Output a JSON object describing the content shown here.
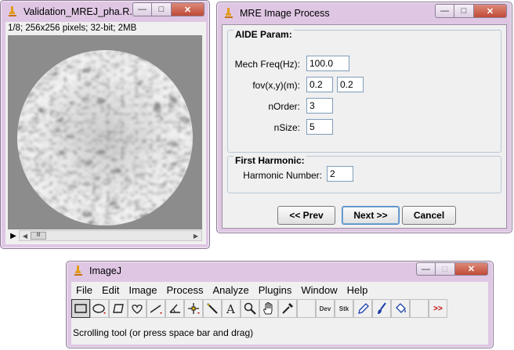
{
  "image_window": {
    "title": "Validation_MREJ_pha.R...",
    "info": "1/8; 256x256 pixels; 32-bit; 2MB",
    "scroll_thumb": "lll"
  },
  "mre_dialog": {
    "title": "MRE Image Process",
    "aide_section": "AIDE Param:",
    "mech_freq_label": "Mech Freq(Hz):",
    "mech_freq_value": "100.0",
    "fov_label": "fov(x,y)(m):",
    "fov_x_value": "0.2",
    "fov_y_value": "0.2",
    "norder_label": "nOrder:",
    "norder_value": "3",
    "nsize_label": "nSize:",
    "nsize_value": "5",
    "harmonic_section": "First Harmonic:",
    "harmonic_label": "Harmonic Number:",
    "harmonic_value": "2",
    "prev_button": "<< Prev",
    "next_button": "Next >>",
    "cancel_button": "Cancel"
  },
  "imagej": {
    "title": "ImageJ",
    "menus": [
      "File",
      "Edit",
      "Image",
      "Process",
      "Analyze",
      "Plugins",
      "Window",
      "Help"
    ],
    "tools": [
      {
        "name": "rectangle-tool",
        "icon": "rectangle-icon"
      },
      {
        "name": "oval-tool",
        "icon": "oval-icon"
      },
      {
        "name": "polygon-tool",
        "icon": "polygon-icon"
      },
      {
        "name": "freehand-tool",
        "icon": "freehand-icon"
      },
      {
        "name": "line-tool",
        "icon": "line-icon"
      },
      {
        "name": "angle-tool",
        "icon": "angle-icon"
      },
      {
        "name": "point-tool",
        "icon": "point-icon"
      },
      {
        "name": "wand-tool",
        "icon": "wand-icon"
      },
      {
        "name": "text-tool",
        "icon": "text-icon"
      },
      {
        "name": "magnifier-tool",
        "icon": "magnifier-icon"
      },
      {
        "name": "scroll-tool",
        "icon": "hand-icon"
      },
      {
        "name": "color-picker-tool",
        "icon": "eyedropper-icon"
      },
      {
        "name": "blank-tool",
        "icon": "blank-icon"
      },
      {
        "name": "dev-tool",
        "icon": "dev-icon",
        "label": "Dev"
      },
      {
        "name": "stk-tool",
        "icon": "stk-icon",
        "label": "Stk"
      },
      {
        "name": "pencil-tool",
        "icon": "pencil-icon"
      },
      {
        "name": "brush-tool",
        "icon": "brush-icon"
      },
      {
        "name": "flood-fill-tool",
        "icon": "bucket-icon"
      },
      {
        "name": "blank-tool-2",
        "icon": "blank-icon"
      },
      {
        "name": "more-tools",
        "icon": "double-chevron-icon",
        "label": ">>"
      }
    ],
    "status": "Scrolling tool (or press space bar and drag)"
  },
  "colors": {
    "window_frame": "#dfc7e4",
    "close_button": "#c04a36",
    "panel": "#f0f0f0",
    "fieldset_border": "#b8c7d7",
    "tool_accent": "#c00000"
  }
}
